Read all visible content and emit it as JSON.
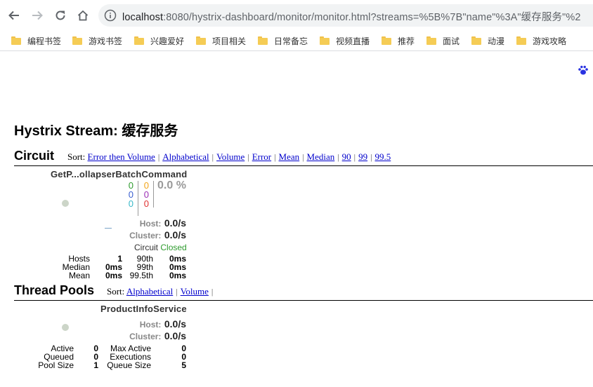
{
  "browser": {
    "url_host": "localhost",
    "url_path": ":8080/hystrix-dashboard/monitor/monitor.html?streams=%5B%7B\"name\"%3A\"缓存服务\"%2",
    "bookmarks": [
      "编程书签",
      "游戏书签",
      "兴趣爱好",
      "项目相关",
      "日常备忘",
      "视频直播",
      "推荐",
      "面试",
      "动漫",
      "游戏攻略"
    ]
  },
  "page": {
    "title": "Hystrix Stream: 缓存服务"
  },
  "circuit_section": {
    "title": "Circuit",
    "sort_label": "Sort:",
    "sort_links": [
      "Error then Volume",
      "Alphabetical",
      "Volume",
      "Error",
      "Mean",
      "Median",
      "90",
      "99",
      "99.5"
    ]
  },
  "command": {
    "name": "GetP...ollapserBatchCommand",
    "counts_left": [
      "0",
      "0",
      "0"
    ],
    "counts_right": [
      "0",
      "0",
      "0"
    ],
    "colors_left": [
      "#2e9b2e",
      "#3a5fd0",
      "#39b8c8"
    ],
    "colors_right": [
      "#f2a51a",
      "#9b2fb5",
      "#e03232"
    ],
    "error_pct": "0.0 %",
    "host_label": "Host:",
    "host_rate": "0.0/s",
    "cluster_label": "Cluster:",
    "cluster_rate": "0.0/s",
    "circuit_label": "Circuit",
    "circuit_status": "Closed",
    "stats": [
      {
        "label": "Hosts",
        "value": "1",
        "p_label": "90th",
        "p_value": "0ms"
      },
      {
        "label": "Median",
        "value": "0ms",
        "p_label": "99th",
        "p_value": "0ms"
      },
      {
        "label": "Mean",
        "value": "0ms",
        "p_label": "99.5th",
        "p_value": "0ms"
      }
    ]
  },
  "threadpool_section": {
    "title": "Thread Pools",
    "sort_label": "Sort:",
    "sort_links": [
      "Alphabetical",
      "Volume"
    ]
  },
  "pool": {
    "name": "ProductInfoService",
    "host_label": "Host:",
    "host_rate": "0.0/s",
    "cluster_label": "Cluster:",
    "cluster_rate": "0.0/s",
    "stats": [
      {
        "label": "Active",
        "value": "0",
        "r_label": "Max Active",
        "r_value": "0"
      },
      {
        "label": "Queued",
        "value": "0",
        "r_label": "Executions",
        "r_value": "0"
      },
      {
        "label": "Pool Size",
        "value": "1",
        "r_label": "Queue Size",
        "r_value": "5"
      }
    ]
  }
}
